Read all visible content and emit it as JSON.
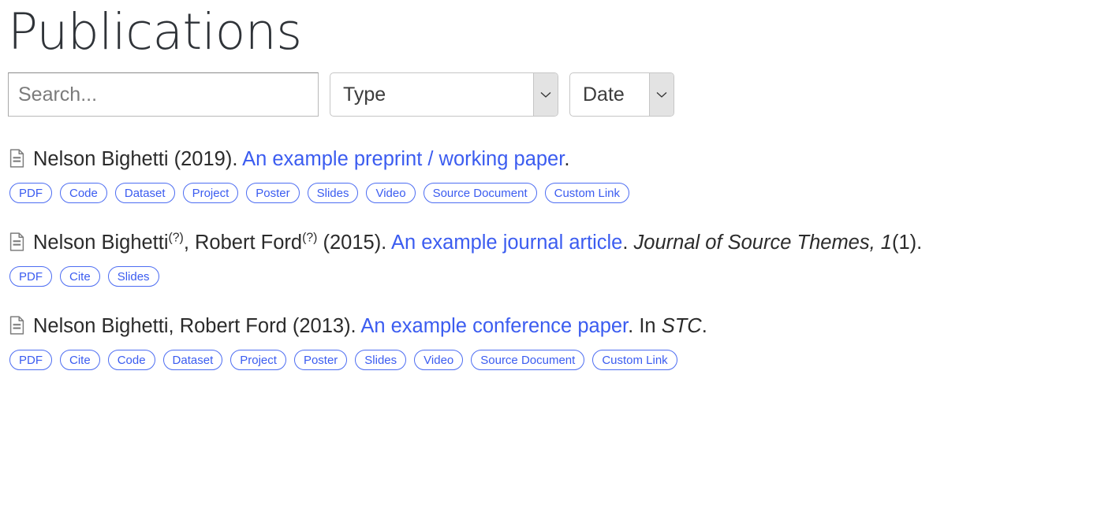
{
  "page": {
    "title": "Publications"
  },
  "filters": {
    "search": {
      "name": "search-input",
      "value": "",
      "placeholder": "Search..."
    },
    "type_select": {
      "label": "Type",
      "icon": "chevron-down-icon"
    },
    "date_select": {
      "label": "Date",
      "icon": "chevron-down-icon"
    }
  },
  "publications": [
    {
      "icon": "document-icon",
      "authors": [
        {
          "name": "Nelson Bighetti",
          "marker": ""
        }
      ],
      "authors_separator": ", ",
      "year": "(2019).",
      "title": "An example preprint / working paper",
      "title_suffix": ".",
      "venue": "",
      "venue_prefix": "",
      "volume": "",
      "issue": "",
      "badges": [
        "PDF",
        "Code",
        "Dataset",
        "Project",
        "Poster",
        "Slides",
        "Video",
        "Source Document",
        "Custom Link"
      ]
    },
    {
      "icon": "document-icon",
      "authors": [
        {
          "name": "Nelson Bighetti",
          "marker": "(?)"
        },
        {
          "name": "Robert Ford",
          "marker": "(?)"
        }
      ],
      "authors_separator": ", ",
      "year": "(2015).",
      "title": "An example journal article",
      "title_suffix": ".",
      "venue": "Journal of Source Themes,",
      "venue_prefix": "",
      "volume": "1",
      "issue": "(1).",
      "badges": [
        "PDF",
        "Cite",
        "Slides"
      ]
    },
    {
      "icon": "document-icon",
      "authors": [
        {
          "name": "Nelson Bighetti",
          "marker": ""
        },
        {
          "name": "Robert Ford",
          "marker": ""
        }
      ],
      "authors_separator": ", ",
      "year": "(2013).",
      "title": "An example conference paper",
      "title_suffix": ".",
      "venue": "STC",
      "venue_prefix": "In ",
      "venue_suffix": ".",
      "volume": "",
      "issue": "",
      "badges": [
        "PDF",
        "Cite",
        "Code",
        "Dataset",
        "Project",
        "Poster",
        "Slides",
        "Video",
        "Source Document",
        "Custom Link"
      ]
    }
  ],
  "colors": {
    "link_blue": "#3b5cf0",
    "badge_border": "#4d6df2",
    "text": "#2b2b2b",
    "icon_gray": "#7d7d7d",
    "placeholder": "#7b7b7b"
  }
}
